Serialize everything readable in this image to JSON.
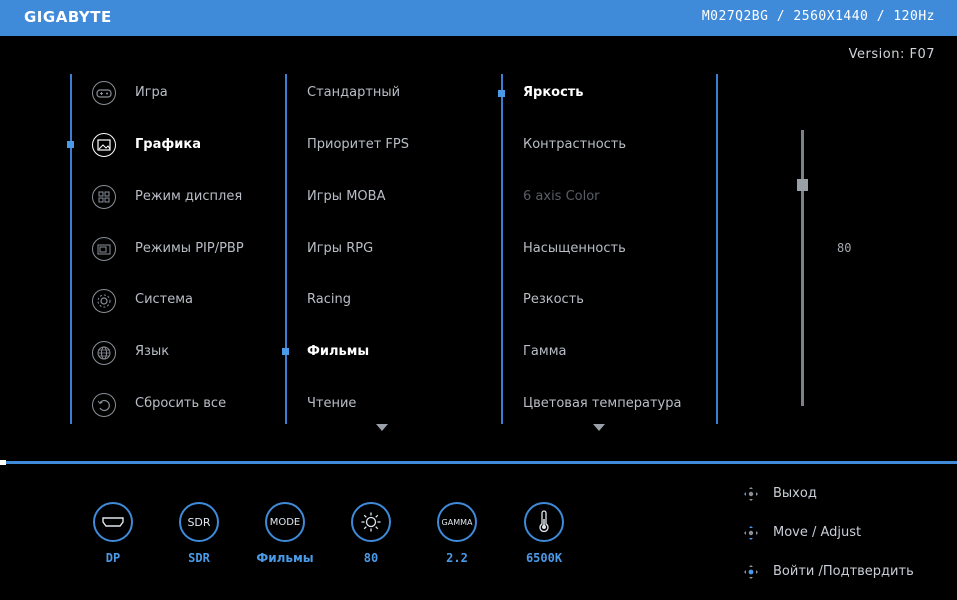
{
  "header": {
    "brand": "GIGABYTE",
    "model_info": "M027Q2BG / 2560X1440 / 120Hz",
    "version": "Version: F07"
  },
  "main_menu": {
    "items": [
      {
        "label": "Игра",
        "icon": "gamepad-icon"
      },
      {
        "label": "Графика",
        "icon": "picture-icon",
        "active": true
      },
      {
        "label": "Режим дисплея",
        "icon": "display-mode-icon"
      },
      {
        "label": "Режимы PIP/PBP",
        "icon": "pip-icon"
      },
      {
        "label": "Система",
        "icon": "system-gear-icon"
      },
      {
        "label": "Язык",
        "icon": "globe-icon"
      },
      {
        "label": "Сбросить все",
        "icon": "reset-icon"
      }
    ]
  },
  "picture_modes": {
    "items": [
      "Стандартный",
      "Приоритет FPS",
      "Игры MOBA",
      "Игры RPG",
      "Racing",
      "Фильмы",
      "Чтение"
    ],
    "selected": "Фильмы"
  },
  "settings": {
    "items": [
      "Яркость",
      "Контрастность",
      "6 axis Color",
      "Насыщенность",
      "Резкость",
      "Гамма",
      "Цветовая температура"
    ],
    "selected": "Яркость",
    "disabled": "6 axis Color"
  },
  "slider": {
    "value": 80,
    "max": 100,
    "value_label": "80"
  },
  "status_bar": [
    {
      "icon_text": "",
      "label": "DP",
      "icon": "hdmi-port-icon"
    },
    {
      "icon_text": "SDR",
      "label": "SDR",
      "icon": "sdr-icon"
    },
    {
      "icon_text": "MODE",
      "label": "Фильмы",
      "icon": "mode-icon"
    },
    {
      "icon_text": "",
      "label": "80",
      "icon": "brightness-sun-icon"
    },
    {
      "icon_text": "GAMMA",
      "label": "2.2",
      "icon": "gamma-icon"
    },
    {
      "icon_text": "",
      "label": "6500K",
      "icon": "thermometer-icon"
    }
  ],
  "nav_hints": [
    {
      "label": "Выход",
      "icon": "joystick-left-icon"
    },
    {
      "label": "Move / Adjust",
      "icon": "joystick-updown-icon"
    },
    {
      "label": "Войти /Подтвердить",
      "icon": "joystick-press-icon"
    }
  ],
  "colors": {
    "accent": "#3f8ad9",
    "marker": "#4a9ae8",
    "background": "#000000"
  }
}
